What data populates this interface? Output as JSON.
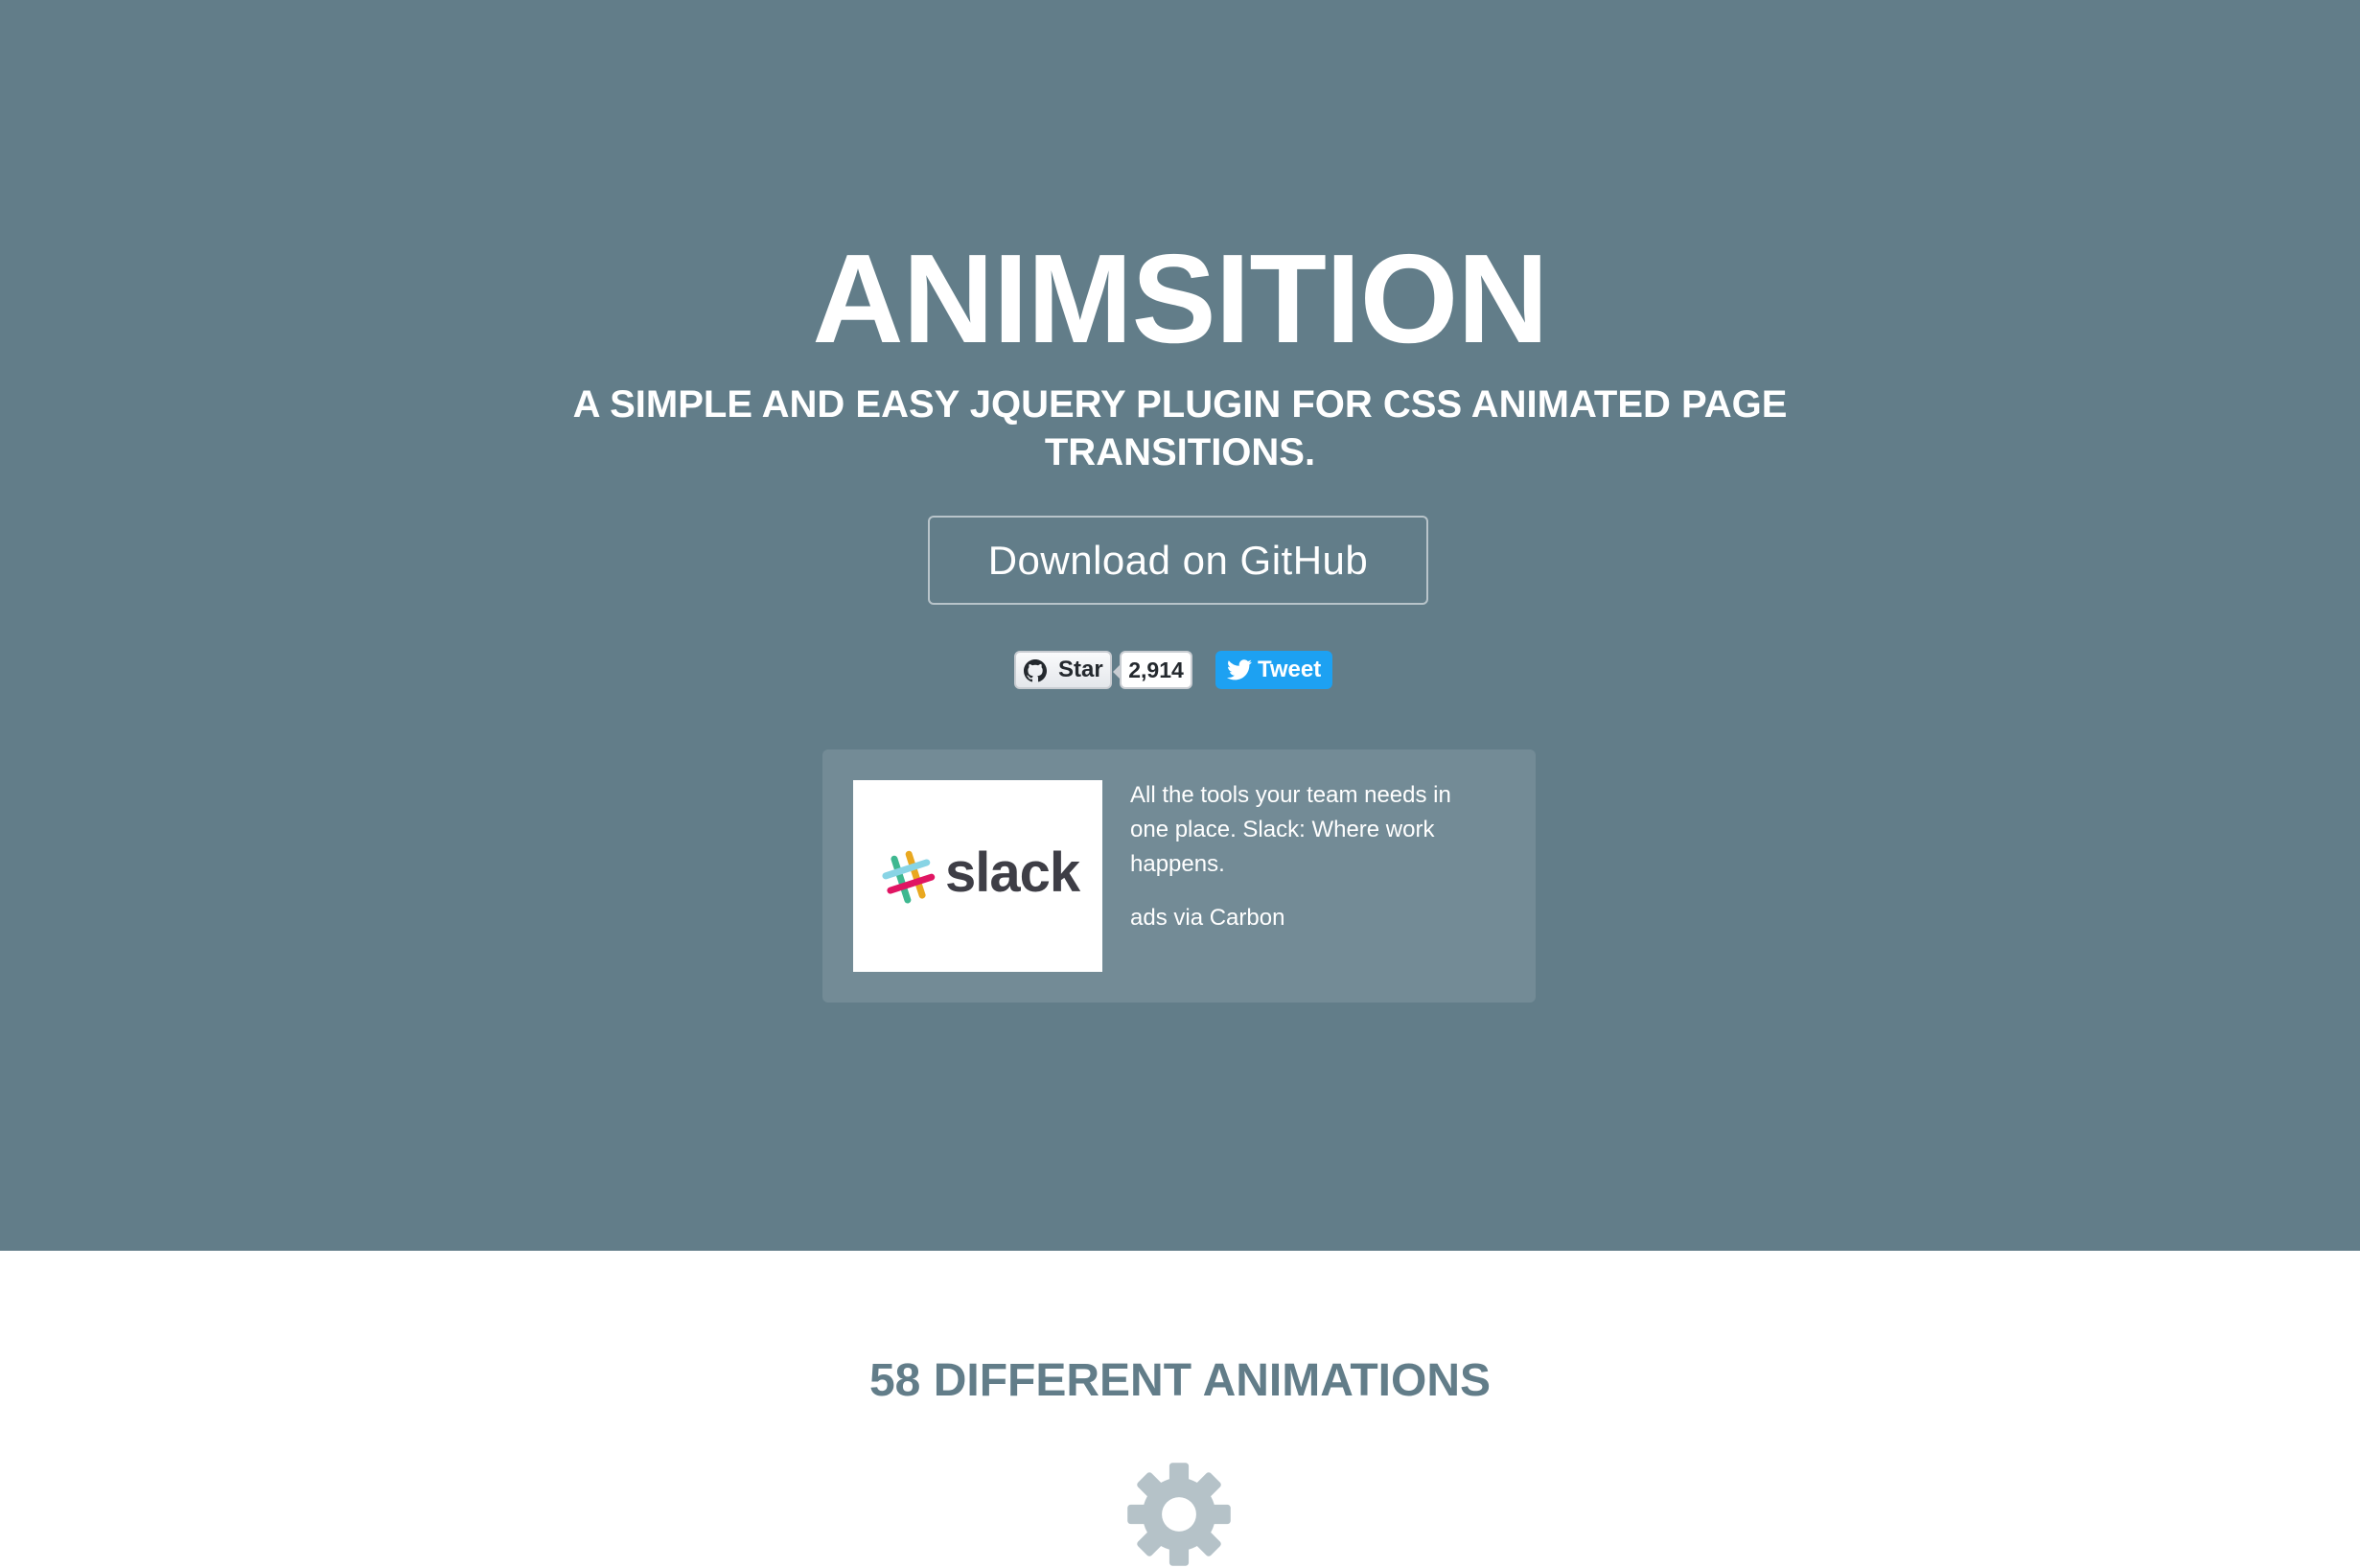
{
  "hero": {
    "title": "ANIMSITION",
    "subtitle": "A SIMPLE AND EASY JQUERY PLUGIN FOR CSS ANIMATED PAGE TRANSITIONS.",
    "download_label": "Download on GitHub",
    "background_color": "#627d89"
  },
  "social": {
    "star_label": "Star",
    "star_count": "2,914",
    "tweet_label": "Tweet",
    "icons": [
      "github-icon",
      "twitter-bird-icon"
    ]
  },
  "ad": {
    "image_brand": "slack",
    "text": "All the tools your team needs in one place. Slack: Where work happens.",
    "via": "ads via Carbon"
  },
  "features": {
    "title": "58 DIFFERENT ANIMATIONS",
    "icon": "gear-icon"
  }
}
